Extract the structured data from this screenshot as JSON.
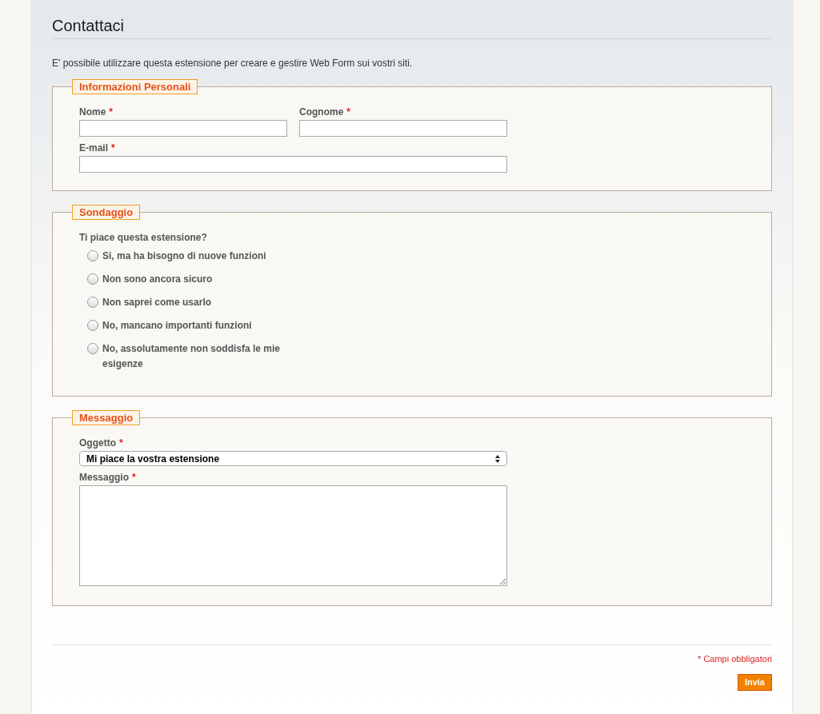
{
  "title": "Contattaci",
  "intro": "E' possibile utilizzare questa estensione per creare e gestire Web Form sui vostri siti.",
  "personal": {
    "legend": "Informazioni Personali",
    "fields": [
      {
        "label": "Nome",
        "mark": "*"
      },
      {
        "label": "Cognome",
        "mark": "*"
      },
      {
        "label": "E-mail",
        "mark": "*"
      }
    ]
  },
  "survey": {
    "legend": "Sondaggio",
    "question": "Ti piace questa estensione?",
    "options": [
      {
        "label": "Si, ma ha bisogno di nuove funzioni",
        "selected": false
      },
      {
        "label": "Non sono ancora sicuro",
        "selected": false
      },
      {
        "label": "Non saprei come usarlo",
        "selected": false
      },
      {
        "label": "No, mancano importanti funzioni",
        "selected": false
      },
      {
        "label": "No, assolutamente non soddisfa le mie esigenze",
        "selected": false
      }
    ]
  },
  "message": {
    "legend": "Messaggio",
    "subject": {
      "label": "Oggetto",
      "mark": "*",
      "value": "Mi piace la vostra estensione"
    },
    "body": {
      "label": "Messaggio",
      "mark": "*"
    }
  },
  "required_note": "* Campi obbligatori",
  "submit": "Invia"
}
